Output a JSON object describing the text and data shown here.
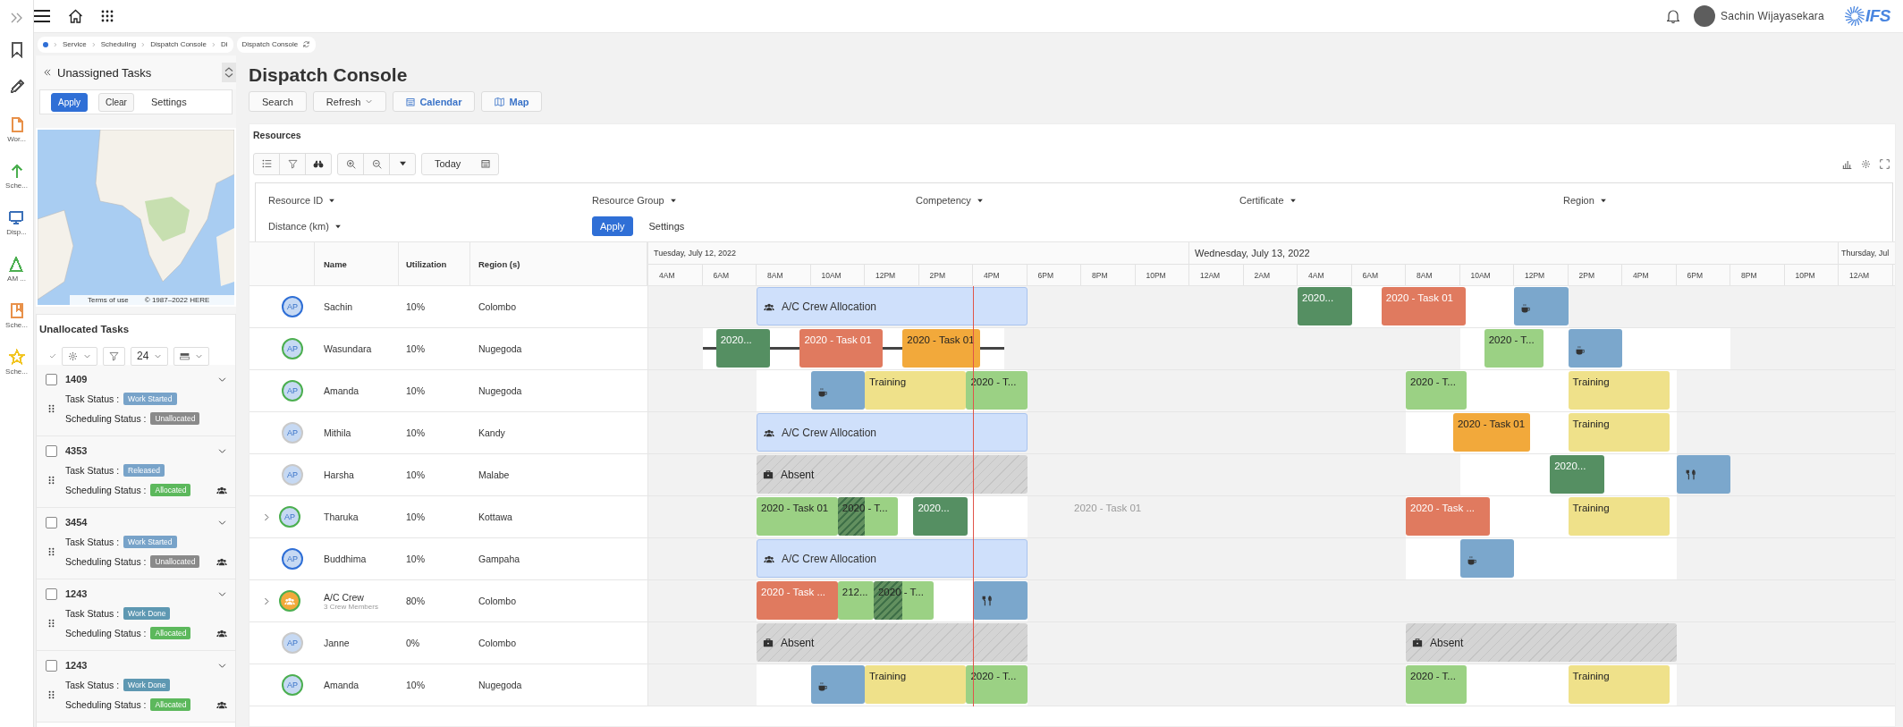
{
  "rail": {
    "items": [
      {
        "kind": "bookmark"
      },
      {
        "kind": "pencil"
      },
      {
        "kind": "document",
        "label": "Wor...",
        "color": "#e8914a"
      },
      {
        "kind": "arrow",
        "label": "Sche...",
        "color": "#4caf50"
      },
      {
        "kind": "monitor",
        "label": "Disp...",
        "color": "#3a6fb8"
      },
      {
        "kind": "triangle",
        "label": "AM ...",
        "color": "#4caf50"
      },
      {
        "kind": "book",
        "label": "Sche...",
        "color": "#e8914a"
      },
      {
        "kind": "star",
        "label": "Sche...",
        "color": "#f2c522"
      }
    ]
  },
  "topbar": {
    "user": "Sachin Wijayasekara",
    "logo": "IFS"
  },
  "breadcrumb": {
    "items": [
      "Service",
      "Scheduling",
      "Dispatch Console",
      "Di"
    ],
    "tab": "Dispatch Console"
  },
  "unassigned_panel": {
    "title": "Unassigned Tasks",
    "buttons": [
      {
        "label": "Apply",
        "kind": "primary"
      },
      {
        "label": "Clear",
        "kind": "secondary"
      },
      {
        "label": "Settings",
        "kind": "link"
      }
    ],
    "map": {
      "attribution": [
        "Terms of use",
        "© 1987–2022 HERE"
      ]
    },
    "unallocated": {
      "title": "Unallocated Tasks",
      "page_size": "24",
      "tasks": [
        {
          "id": "1409",
          "checked": false,
          "task_status_label": "Task Status :",
          "task_status": {
            "label": "Work Started",
            "color": "#78a3c9"
          },
          "scheduling_status_label": "Scheduling Status :",
          "scheduling_status": {
            "label": "Unallocated",
            "color": "#8a8a8a"
          },
          "crew": false
        },
        {
          "id": "4353",
          "checked": false,
          "task_status_label": "Task Status :",
          "task_status": {
            "label": "Released",
            "color": "#78a3c9"
          },
          "scheduling_status_label": "Scheduling Status :",
          "scheduling_status": {
            "label": "Allocated",
            "color": "#5cb85c"
          },
          "crew": true
        },
        {
          "id": "3454",
          "checked": false,
          "task_status_label": "Task Status :",
          "task_status": {
            "label": "Work Started",
            "color": "#78a3c9"
          },
          "scheduling_status_label": "Scheduling Status :",
          "scheduling_status": {
            "label": "Unallocated",
            "color": "#8a8a8a"
          },
          "crew": true
        },
        {
          "id": "1243",
          "checked": false,
          "task_status_label": "Task Status :",
          "task_status": {
            "label": "Work Done",
            "color": "#5e98b2"
          },
          "scheduling_status_label": "Scheduling Status :",
          "scheduling_status": {
            "label": "Allocated",
            "color": "#5cb85c"
          },
          "crew": true
        },
        {
          "id": "1243",
          "checked": false,
          "task_status_label": "Task Status :",
          "task_status": {
            "label": "Work Done",
            "color": "#5e98b2"
          },
          "scheduling_status_label": "Scheduling Status :",
          "scheduling_status": {
            "label": "Allocated",
            "color": "#5cb85c"
          },
          "crew": true
        }
      ]
    }
  },
  "console": {
    "title": "Dispatch Console",
    "buttons": [
      {
        "label": "Search",
        "kind": "plain"
      },
      {
        "label": "Refresh",
        "kind": "dropdown"
      },
      {
        "label": "Calendar",
        "kind": "calendar"
      },
      {
        "label": "Map",
        "kind": "map"
      }
    ],
    "resources": {
      "title": "Resources",
      "today": "Today",
      "filters": [
        {
          "label": "Resource ID"
        },
        {
          "label": "Resource Group"
        },
        {
          "label": "Competency"
        },
        {
          "label": "Certificate"
        },
        {
          "label": "Region"
        },
        {
          "label": "Distance (km)"
        }
      ],
      "filter_buttons": [
        {
          "label": "Apply",
          "kind": "primary"
        },
        {
          "label": "Settings",
          "kind": "link"
        }
      ],
      "gantt": {
        "columns": [
          "Name",
          "Utilization",
          "Region (s)"
        ],
        "days": [
          {
            "label": "Tuesday, July 12, 2022",
            "hours": [
              "4AM",
              "6AM",
              "8AM",
              "10AM",
              "12PM",
              "2PM",
              "4PM",
              "6PM",
              "8PM",
              "10PM"
            ]
          },
          {
            "label": "Wednesday, July 13, 2022",
            "hours": [
              "12AM",
              "2AM",
              "4AM",
              "6AM",
              "8AM",
              "10AM",
              "12PM",
              "2PM",
              "4PM",
              "6PM",
              "8PM",
              "10PM"
            ]
          },
          {
            "label": "Thursday, Jul",
            "hours": [
              "12AM"
            ]
          }
        ],
        "resources": [
          {
            "name": "Sachin",
            "utilization": "10%",
            "region": "Colombo",
            "avatar": {
              "kind": "person",
              "initials": "AP",
              "color": "#2f6fd6"
            },
            "events": [
              {
                "kind": "allocation",
                "label": "A/C Crew Allocation",
                "color": "#cfe0fb"
              },
              {
                "kind": "task",
                "label": "2020...",
                "color": "#558f62"
              },
              {
                "kind": "task",
                "label": "2020 - Task 01",
                "color": "#e07a5f"
              },
              {
                "kind": "break",
                "color": "#7ba7cc"
              }
            ]
          },
          {
            "name": "Wasundara",
            "utilization": "10%",
            "region": "Nugegoda",
            "avatar": {
              "kind": "person",
              "initials": "AP",
              "color": "#4caf50"
            },
            "events": [
              {
                "kind": "route"
              },
              {
                "kind": "task",
                "label": "2020...",
                "color": "#558f62"
              },
              {
                "kind": "task",
                "label": "2020 - Task 01",
                "color": "#e07a5f"
              },
              {
                "kind": "task",
                "label": "2020 - Task 01",
                "color": "#f2a93b"
              },
              {
                "kind": "task",
                "label": "2020 - T...",
                "color": "#9bd184"
              },
              {
                "kind": "break",
                "color": "#7ba7cc"
              }
            ]
          },
          {
            "name": "Amanda",
            "utilization": "10%",
            "region": "Nugegoda",
            "avatar": {
              "kind": "person",
              "initials": "AP",
              "color": "#4caf50"
            },
            "events": [
              {
                "kind": "break",
                "color": "#7ba7cc"
              },
              {
                "kind": "training",
                "label": "Training",
                "color": "#efe18a"
              },
              {
                "kind": "task",
                "label": "2020 - T...",
                "color": "#9bd184"
              },
              {
                "kind": "task",
                "label": "2020 - T...",
                "color": "#9bd184"
              },
              {
                "kind": "training",
                "label": "Training",
                "color": "#efe18a"
              }
            ]
          },
          {
            "name": "Mithila",
            "utilization": "10%",
            "region": "Kandy",
            "avatar": {
              "kind": "person",
              "initials": "AP",
              "color": "#c9c9c9"
            },
            "events": [
              {
                "kind": "allocation",
                "label": "A/C Crew Allocation",
                "color": "#cfe0fb"
              },
              {
                "kind": "task",
                "label": "2020 - Task 01",
                "color": "#f2a93b"
              },
              {
                "kind": "training",
                "label": "Training",
                "color": "#efe18a"
              }
            ]
          },
          {
            "name": "Harsha",
            "utilization": "10%",
            "region": "Malabe",
            "avatar": {
              "kind": "person",
              "initials": "AP",
              "color": "#c9c9c9"
            },
            "events": [
              {
                "kind": "absent",
                "label": "Absent"
              },
              {
                "kind": "task",
                "label": "2020...",
                "color": "#558f62"
              },
              {
                "kind": "meal",
                "color": "#7ba7cc"
              }
            ]
          },
          {
            "name": "Tharuka",
            "utilization": "10%",
            "region": "Kottawa",
            "expanded": false,
            "avatar": {
              "kind": "person",
              "initials": "AP",
              "color": "#4caf50"
            },
            "events": [
              {
                "kind": "task",
                "label": "2020 - Task 01",
                "color": "#9bd184"
              },
              {
                "kind": "task",
                "label": "2020 - T...",
                "color": "#9bd184",
                "overlap": true
              },
              {
                "kind": "task",
                "label": "2020...",
                "color": "#558f62"
              },
              {
                "kind": "ghost",
                "label": "2020 - Task 01"
              },
              {
                "kind": "task",
                "label": "2020 - Task ...",
                "color": "#e07a5f"
              },
              {
                "kind": "training",
                "label": "Training",
                "color": "#efe18a"
              }
            ]
          },
          {
            "name": "Buddhima",
            "utilization": "10%",
            "region": "Gampaha",
            "avatar": {
              "kind": "person",
              "initials": "AP",
              "color": "#2f6fd6"
            },
            "events": [
              {
                "kind": "allocation",
                "label": "A/C Crew Allocation",
                "color": "#cfe0fb"
              },
              {
                "kind": "break",
                "color": "#7ba7cc"
              }
            ]
          },
          {
            "name": "A/C Crew",
            "members": "3 Crew Members",
            "utilization": "80%",
            "region": "Colombo",
            "expanded": false,
            "avatar": {
              "kind": "crew",
              "color": "#4caf50"
            },
            "events": [
              {
                "kind": "task",
                "label": "2020 - Task ...",
                "color": "#e07a5f"
              },
              {
                "kind": "task",
                "label": "212...",
                "color": "#9bd184"
              },
              {
                "kind": "task",
                "label": "2020 - T...",
                "color": "#9bd184",
                "overlap": true
              },
              {
                "kind": "meal",
                "color": "#7ba7cc"
              }
            ]
          },
          {
            "name": "Janne",
            "utilization": "0%",
            "region": "Colombo",
            "avatar": {
              "kind": "person",
              "initials": "AP",
              "color": "#c9c9c9"
            },
            "events": [
              {
                "kind": "absent",
                "label": "Absent"
              },
              {
                "kind": "absent",
                "label": "Absent"
              }
            ]
          },
          {
            "name": "Amanda",
            "utilization": "10%",
            "region": "Nugegoda",
            "avatar": {
              "kind": "person",
              "initials": "AP",
              "color": "#4caf50"
            },
            "events": [
              {
                "kind": "break",
                "color": "#7ba7cc"
              },
              {
                "kind": "training",
                "label": "Training",
                "color": "#efe18a"
              },
              {
                "kind": "task",
                "label": "2020 - T...",
                "color": "#9bd184"
              },
              {
                "kind": "task",
                "label": "2020 - T...",
                "color": "#9bd184"
              },
              {
                "kind": "training",
                "label": "Training",
                "color": "#efe18a"
              }
            ]
          }
        ]
      }
    }
  }
}
